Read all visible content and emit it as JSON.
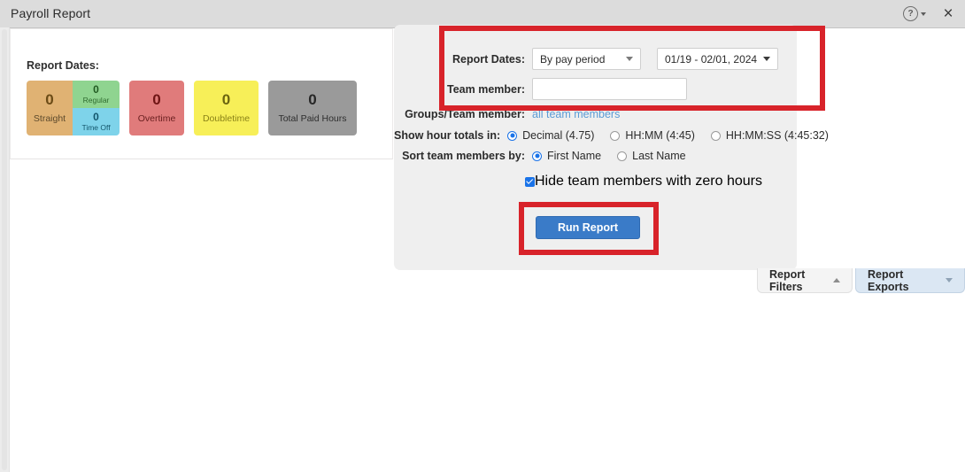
{
  "window": {
    "title": "Payroll Report",
    "help_icon": "help-icon",
    "help_caret": "caret-down-icon",
    "close_icon": "×",
    "help_glyph": "?"
  },
  "summary": {
    "label": "Report Dates:",
    "cards": [
      {
        "type": "split",
        "left": {
          "value": "0",
          "caption": "Straight"
        },
        "top_right": {
          "value": "0",
          "caption": "Regular"
        },
        "bottom_right": {
          "value": "0",
          "caption": "Time Off"
        }
      },
      {
        "type": "simple",
        "value": "0",
        "caption": "Overtime"
      },
      {
        "type": "simple",
        "value": "0",
        "caption": "Doubletime"
      },
      {
        "type": "simple",
        "value": "0",
        "caption": "Total Paid Hours"
      }
    ]
  },
  "filters": {
    "report_dates": {
      "label": "Report Dates:",
      "period_value": "By pay period",
      "range_value": "01/19 - 02/01, 2024"
    },
    "team_member": {
      "label": "Team member:",
      "value": "",
      "placeholder": ""
    },
    "groups_team_member": {
      "label": "Groups/Team member:",
      "link_text": "all team members"
    },
    "hour_totals": {
      "label": "Show hour totals in:",
      "options": [
        {
          "text": "Decimal (4.75)",
          "selected": true
        },
        {
          "text": "HH:MM (4:45)",
          "selected": false
        },
        {
          "text": "HH:MM:SS (4:45:32)",
          "selected": false
        }
      ]
    },
    "sort_by": {
      "label": "Sort team members by:",
      "options": [
        {
          "text": "First Name",
          "selected": true
        },
        {
          "text": "Last Name",
          "selected": false
        }
      ]
    },
    "hide_zero": {
      "text": "Hide team members with zero hours",
      "checked": true
    },
    "run_button": "Run Report"
  },
  "tabs": [
    {
      "label": "Report Filters",
      "icon": "chevron-up-icon",
      "active": false
    },
    {
      "label": "Report Exports",
      "icon": "chevron-down-icon",
      "active": true
    }
  ],
  "colors": {
    "accent_blue": "#1a73e8",
    "button_blue": "#3a7bc8",
    "highlight_red": "#d8232a",
    "link_blue": "#5b9bd5",
    "card_straight": "#e0b273",
    "card_regular": "#8fd490",
    "card_timeoff": "#7ed3ea",
    "card_overtime": "#e07b7b",
    "card_doubletime": "#f7ef58",
    "card_total": "#9a9a9a"
  }
}
